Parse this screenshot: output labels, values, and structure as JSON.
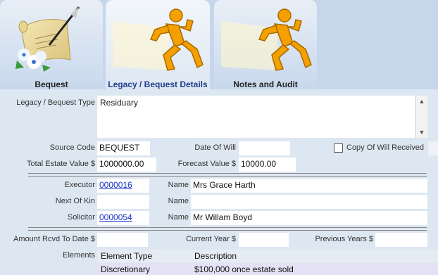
{
  "tabs": [
    {
      "label": "Bequest",
      "icon": "scroll-quill-icon"
    },
    {
      "label": "Legacy / Bequest Details",
      "icon": "running-man-icon"
    },
    {
      "label": "Notes and Audit",
      "icon": "running-man-icon"
    }
  ],
  "form": {
    "type_label": "Legacy / Bequest Type",
    "type_value": "Residuary",
    "source_code_label": "Source Code",
    "source_code_value": "BEQUEST",
    "date_of_will_label": "Date Of Will",
    "date_of_will_value": "",
    "copy_of_will_label": "Copy Of Will Received",
    "total_estate_label": "Total Estate Value $",
    "total_estate_value": "1000000.00",
    "forecast_label": "Forecast Value $",
    "forecast_value": "10000.00",
    "executor_label": "Executor",
    "executor_value": "0000016",
    "executor_name_label": "Name",
    "executor_name_value": "Mrs Grace Harth",
    "next_of_kin_label": "Next Of Kin",
    "next_of_kin_value": "",
    "next_of_kin_name_label": "Name",
    "next_of_kin_name_value": "",
    "solicitor_label": "Solicitor",
    "solicitor_value": "0000054",
    "solicitor_name_label": "Name",
    "solicitor_name_value": "Mr Willam Boyd",
    "amount_rcvd_label": "Amount Rcvd To Date $",
    "amount_rcvd_value": "",
    "current_year_label": "Current Year $",
    "current_year_value": "",
    "previous_years_label": "Previous Years $",
    "previous_years_value": ""
  },
  "elements": {
    "label": "Elements",
    "columns": [
      "Element Type",
      "Description"
    ],
    "rows": [
      {
        "type": "Discretionary",
        "description": "$100,000 once estate sold"
      }
    ]
  },
  "colors": {
    "link": "#1a33cc",
    "active_tab_text": "#1f3f8f",
    "running_man": "#f5a000"
  }
}
